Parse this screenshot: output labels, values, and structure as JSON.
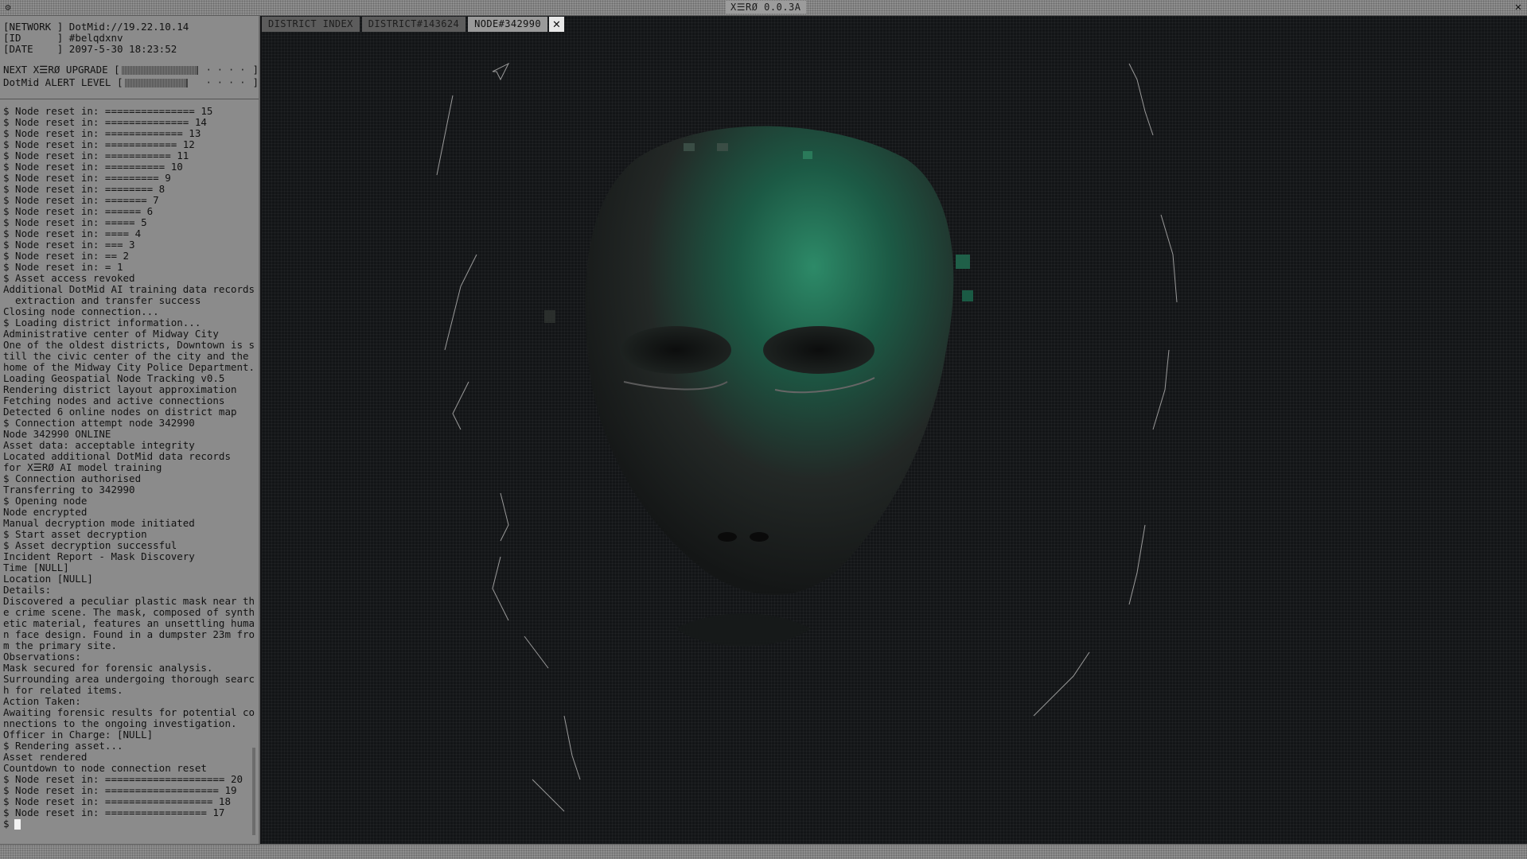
{
  "window": {
    "title": "X☰RØ 0.0.3A",
    "icon": "gear-icon",
    "close": "✕"
  },
  "status": {
    "network_label": "[NETWORK ]",
    "network_value": "DotMid://19.22.10.14",
    "id_label": "[ID      ]",
    "id_value": "#belqdxnv",
    "date_label": "[DATE    ]",
    "date_value": "2097-5-30 18:23:52"
  },
  "meters": {
    "upgrade_label": "NEXT X☰RØ UPGRADE [",
    "upgrade_level": 0.55,
    "alert_label": "DotMid ALERT LEVEL [",
    "alert_level": 0.45,
    "dots": "····",
    "close_bracket": "]"
  },
  "log": [
    "$ Node reset in: =============== 15",
    "$ Node reset in: ============== 14",
    "$ Node reset in: ============= 13",
    "$ Node reset in: ============ 12",
    "$ Node reset in: =========== 11",
    "$ Node reset in: ========== 10",
    "$ Node reset in: ========= 9",
    "$ Node reset in: ======== 8",
    "$ Node reset in: ======= 7",
    "$ Node reset in: ====== 6",
    "$ Node reset in: ===== 5",
    "$ Node reset in: ==== 4",
    "$ Node reset in: === 3",
    "$ Node reset in: == 2",
    "$ Node reset in: = 1",
    "$ Asset access revoked",
    "Additional DotMid AI training data records",
    "  extraction and transfer success",
    "Closing node connection...",
    "$ Loading district information...",
    "Administrative center of Midway City",
    "One of the oldest districts, Downtown is s",
    "till the civic center of the city and the",
    "home of the Midway City Police Department.",
    "Loading Geospatial Node Tracking v0.5",
    "Rendering district layout approximation",
    "Fetching nodes and active connections",
    "Detected 6 online nodes on district map",
    "$ Connection attempt node 342990",
    "Node 342990 ONLINE",
    "Asset data: acceptable integrity",
    "Located additional DotMid data records",
    "for X☰RØ AI model training",
    "$ Connection authorised",
    "Transferring to 342990",
    "$ Opening node",
    "Node encrypted",
    "Manual decryption mode initiated",
    "$ Start asset decryption",
    "$ Asset decryption successful",
    "Incident Report - Mask Discovery",
    "Time [NULL]",
    "Location [NULL]",
    "Details:",
    "Discovered a peculiar plastic mask near th",
    "e crime scene. The mask, composed of synth",
    "etic material, features an unsettling huma",
    "n face design. Found in a dumpster 23m fro",
    "m the primary site.",
    "Observations:",
    "Mask secured for forensic analysis.",
    "Surrounding area undergoing thorough searc",
    "h for related items.",
    "Action Taken:",
    "Awaiting forensic results for potential co",
    "nnections to the ongoing investigation.",
    "Officer in Charge: [NULL]",
    "$ Rendering asset...",
    "Asset rendered",
    "Countdown to node connection reset",
    "$ Node reset in: ==================== 20",
    "$ Node reset in: =================== 19",
    "$ Node reset in: ================== 18",
    "$ Node reset in: ================= 17"
  ],
  "prompt": "$",
  "tabs": [
    {
      "label": "DISTRICT INDEX",
      "active": false
    },
    {
      "label": "DISTRICT#143624",
      "active": false
    },
    {
      "label": "NODE#342990",
      "active": true
    }
  ],
  "tab_close": "✕",
  "colors": {
    "panel_bg": "#8b8b8b",
    "viewport_bg": "#131517",
    "accent_green": "#1e7a5a",
    "text_dark": "#121212"
  }
}
